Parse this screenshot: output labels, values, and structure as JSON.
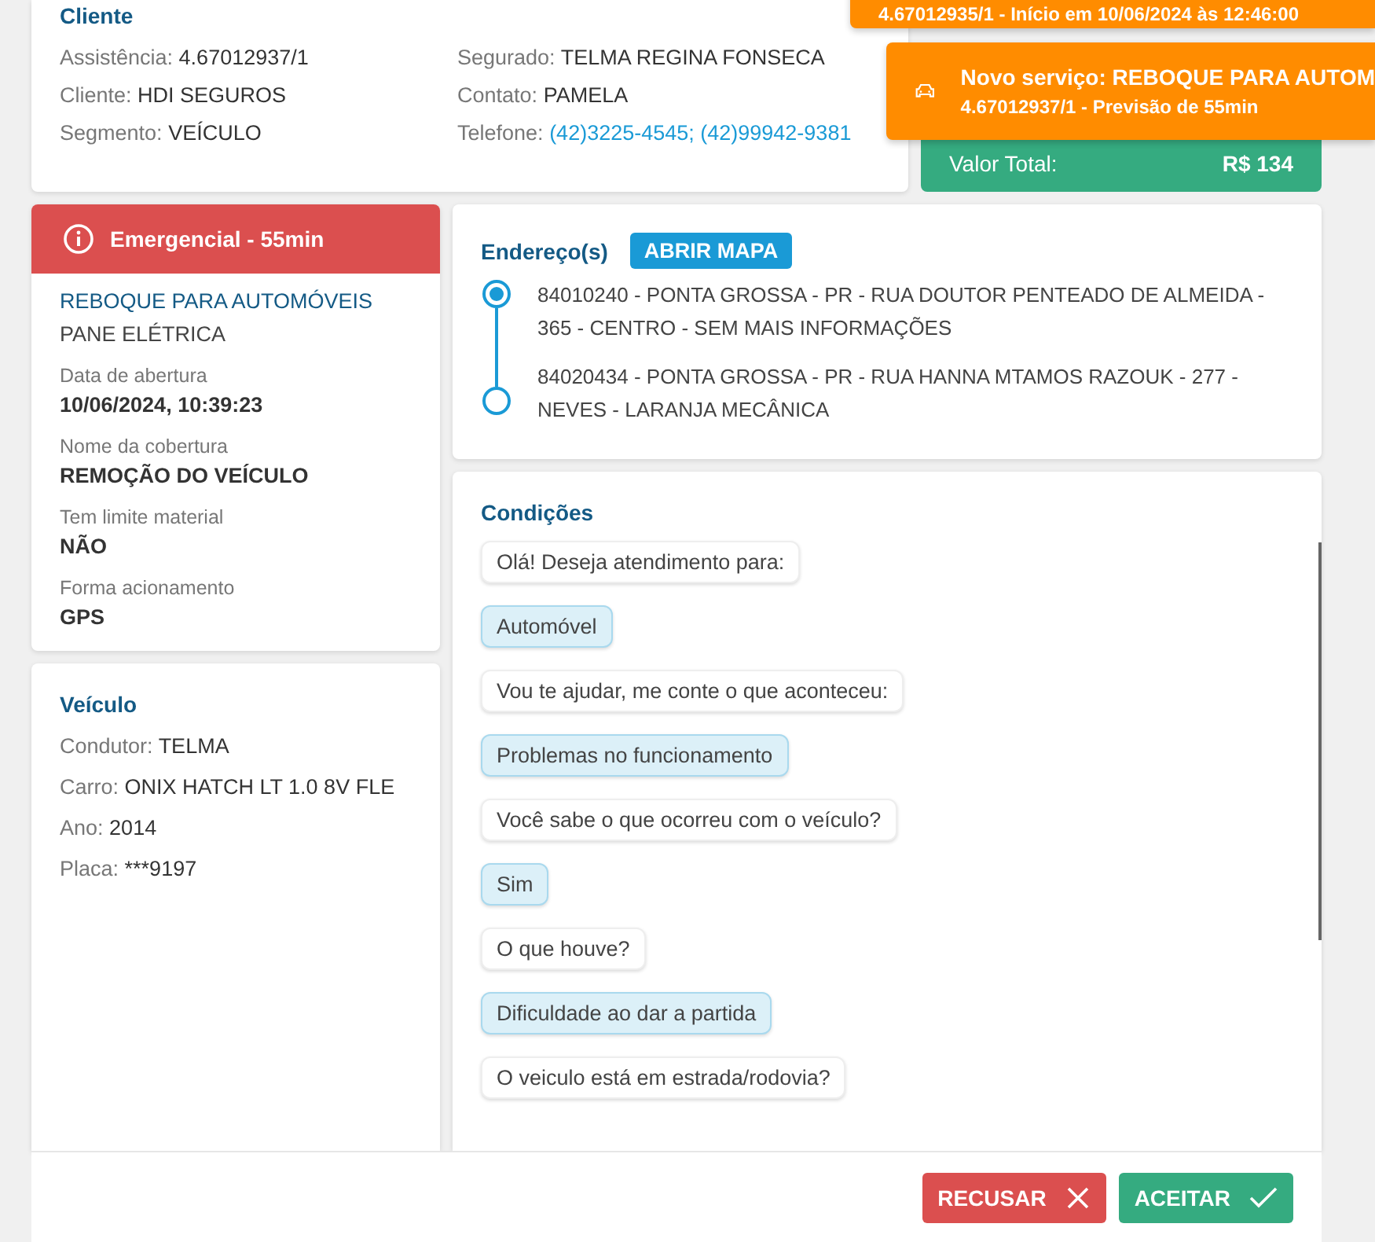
{
  "cliente": {
    "title": "Cliente",
    "fields": [
      {
        "label": "Assistência:",
        "value": "4.67012937/1",
        "kind": "text"
      },
      {
        "label": "Segurado:",
        "value": "TELMA REGINA FONSECA",
        "kind": "text"
      },
      {
        "label": "Cliente:",
        "value": "HDI SEGUROS",
        "kind": "text"
      },
      {
        "label": "Contato:",
        "value": "PAMELA",
        "kind": "text"
      },
      {
        "label": "Segmento:",
        "value": "VEÍCULO",
        "kind": "text"
      },
      {
        "label": "Telefone:",
        "value": "(42)3225-4545; (42)99942-9381",
        "kind": "link"
      }
    ]
  },
  "valor": {
    "label": "Valor Total:",
    "value": "R$ 134"
  },
  "toasts": [
    {
      "subtitle": "4.67012935/1 - Início em 10/06/2024 às 12:46:00"
    },
    {
      "title": "Novo serviço: REBOQUE PARA AUTOM",
      "subtitle": "4.67012937/1 - Previsão de 55min"
    }
  ],
  "servico": {
    "banner": "Emergencial - 55min",
    "name": "REBOQUE PARA AUTOMÓVEIS",
    "problem": "PANE ELÉTRICA",
    "details": [
      {
        "label": "Data de abertura",
        "value": "10/06/2024, 10:39:23"
      },
      {
        "label": "Nome da cobertura",
        "value": "REMOÇÃO DO VEÍCULO"
      },
      {
        "label": "Tem limite material",
        "value": "NÃO"
      },
      {
        "label": "Forma acionamento",
        "value": "GPS"
      }
    ]
  },
  "veiculo": {
    "title": "Veículo",
    "fields": [
      {
        "label": "Condutor:",
        "value": "TELMA"
      },
      {
        "label": "Carro:",
        "value": "ONIX HATCH LT 1.0 8V FLE"
      },
      {
        "label": "Ano:",
        "value": "2014"
      },
      {
        "label": "Placa:",
        "value": "***9197"
      }
    ]
  },
  "enderecos": {
    "title": "Endereço(s)",
    "button": "ABRIR MAPA",
    "stops": [
      {
        "kind": "origin",
        "text": "84010240 - PONTA GROSSA - PR - RUA DOUTOR PENTEADO DE ALMEIDA - 365 - CENTRO - SEM MAIS INFORMAÇÕES"
      },
      {
        "kind": "destination",
        "text": "84020434 - PONTA GROSSA - PR - RUA HANNA MTAMOS RAZOUK - 277 - NEVES - LARANJA MECÂNICA"
      }
    ]
  },
  "condicoes": {
    "title": "Condições",
    "messages": [
      {
        "kind": "question",
        "text": "Olá! Deseja atendimento para:"
      },
      {
        "kind": "answer",
        "text": "Automóvel"
      },
      {
        "kind": "question",
        "text": "Vou te ajudar, me conte o que aconteceu:"
      },
      {
        "kind": "answer",
        "text": "Problemas no funcionamento"
      },
      {
        "kind": "question",
        "text": "Você sabe o que ocorreu com o veículo?"
      },
      {
        "kind": "answer",
        "text": "Sim"
      },
      {
        "kind": "question",
        "text": "O que houve?"
      },
      {
        "kind": "answer",
        "text": "Dificuldade ao dar a partida"
      },
      {
        "kind": "question",
        "text": "O veiculo está em estrada/rodovia?"
      }
    ]
  },
  "actions": [
    {
      "kind": "reject",
      "label": "RECUSAR"
    },
    {
      "kind": "accept",
      "label": "ACEITAR"
    }
  ]
}
